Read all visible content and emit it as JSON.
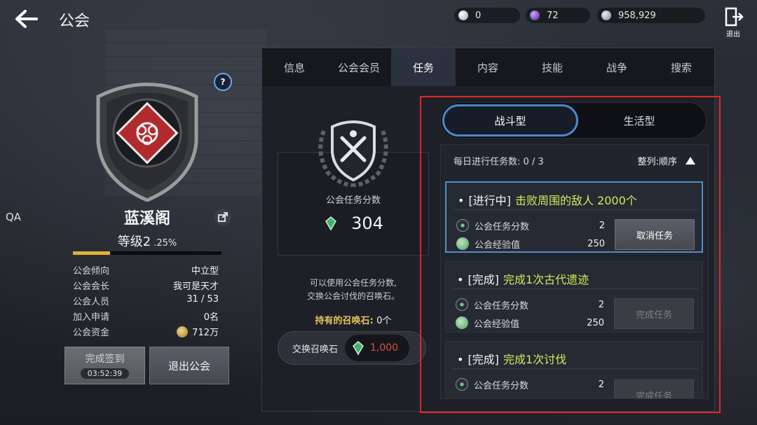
{
  "header": {
    "title": "公会",
    "exit_label": "退出",
    "currencies": [
      {
        "icon": "pearl-icon",
        "value": "0"
      },
      {
        "icon": "purple-gem-icon",
        "value": "72"
      },
      {
        "icon": "silver-coin-icon",
        "value": "958,929"
      }
    ]
  },
  "guild": {
    "qa_label": "QA",
    "name": "蓝溪阁",
    "level": "等级2",
    "progress": ".25%",
    "progress_fraction": 0.25,
    "info": [
      {
        "label": "公会倾向",
        "value": "中立型"
      },
      {
        "label": "公会会长",
        "value": "我可是天才"
      },
      {
        "label": "公会人员",
        "value": "31 / 53"
      },
      {
        "label": "加入申请",
        "value": "0名"
      },
      {
        "label": "公会资金",
        "value": "712万"
      }
    ],
    "checkin_label": "完成签到",
    "checkin_timer": "03:52:39",
    "leave_label": "退出公会"
  },
  "tabs": [
    {
      "label": "信息",
      "active": false
    },
    {
      "label": "公会会员",
      "active": false
    },
    {
      "label": "任务",
      "active": true
    },
    {
      "label": "内容",
      "active": false
    },
    {
      "label": "技能",
      "active": false
    },
    {
      "label": "战争",
      "active": false
    },
    {
      "label": "搜索",
      "active": false
    }
  ],
  "score": {
    "title": "公会任务分数",
    "value": "304",
    "description_1": "可以使用公会任务分数,",
    "description_2": "交换公会讨伐的召唤石。",
    "stones_label": "持有的召唤石:",
    "stones_count": "0个",
    "exchange_label": "交换召唤石",
    "exchange_cost": "1,000"
  },
  "missions": {
    "type_combat": "战斗型",
    "type_life": "生活型",
    "daily_count": "每日进行任务数: 0 / 3",
    "sort_label": "整列:顺序",
    "items": [
      {
        "status": "[进行中]",
        "task": "击败周围的敌人 2000个",
        "rewards": [
          {
            "name": "公会任务分数",
            "value": "2"
          },
          {
            "name": "公会经验值",
            "value": "250"
          }
        ],
        "button": "取消任务"
      },
      {
        "status": "[完成]",
        "task": "完成1次古代遗迹",
        "rewards": [
          {
            "name": "公会任务分数",
            "value": "2"
          },
          {
            "name": "公会经验值",
            "value": "250"
          }
        ],
        "button": "完成任务"
      },
      {
        "status": "[完成]",
        "task": "完成1次讨伐",
        "rewards": [
          {
            "name": "公会任务分数",
            "value": "2"
          }
        ],
        "button": "完成任务"
      }
    ]
  },
  "colors": {
    "accent_blue": "#4d87c7",
    "task_green": "#d6e85a",
    "highlight_red": "#e0262a",
    "xp_gold": "#e3b232",
    "cost_red": "#e34a4a"
  }
}
